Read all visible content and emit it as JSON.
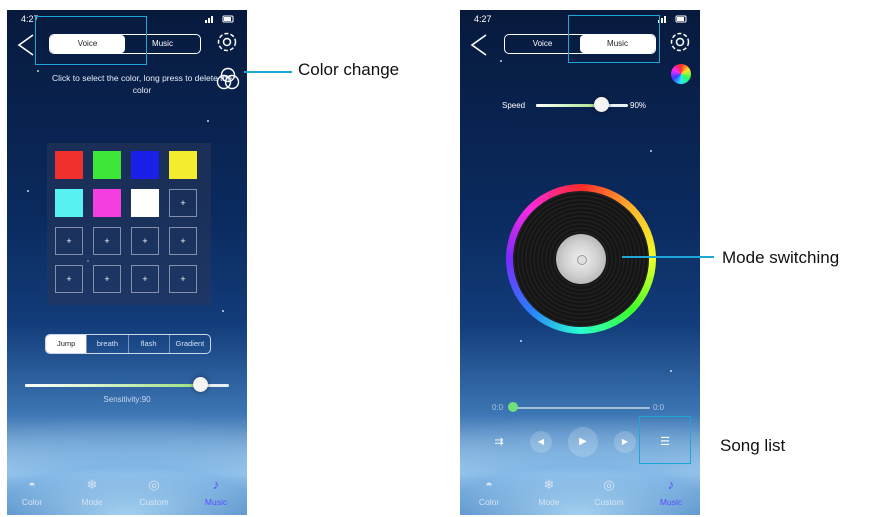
{
  "left_phone": {
    "time": "4:27",
    "segments": {
      "voice": "Voice",
      "music": "Music"
    },
    "hint": "Click to select the color, long press to delete the color",
    "colors": [
      "#f0302c",
      "#3ee63a",
      "#1a20e8",
      "#f4ec2e",
      "#58f2f2",
      "#f43ee0",
      "#ffffff"
    ],
    "empty_label": "+",
    "modes": [
      "Jump",
      "breath",
      "flash",
      "Gradient"
    ],
    "active_mode": "Jump",
    "sensitivity_label": "Sensitivity:90",
    "sensitivity_value": 90
  },
  "right_phone": {
    "time": "4:27",
    "segments": {
      "voice": "Voice",
      "music": "Music"
    },
    "speed_label": "Speed",
    "speed_value_text": "90%",
    "speed_value": 90,
    "progress_start": "0:0",
    "progress_end": "0:0",
    "progress_value": 0.05
  },
  "tabs": {
    "color": "Color",
    "mode": "Mode",
    "custom": "Custom",
    "music": "Music"
  },
  "annotations": {
    "color_change": "Color change",
    "mode_switching": "Mode switching",
    "song_list": "Song list"
  },
  "colors": {
    "highlight": "#1ea6d6",
    "active_tab": "#5a4dff"
  },
  "icons": {
    "back": "chevron-left-icon",
    "settings": "gear-icon",
    "color_change": "three-circles-icon",
    "color_wheel": "color-wheel-icon",
    "record": "vinyl-record-icon",
    "song_list": "list-icon"
  }
}
